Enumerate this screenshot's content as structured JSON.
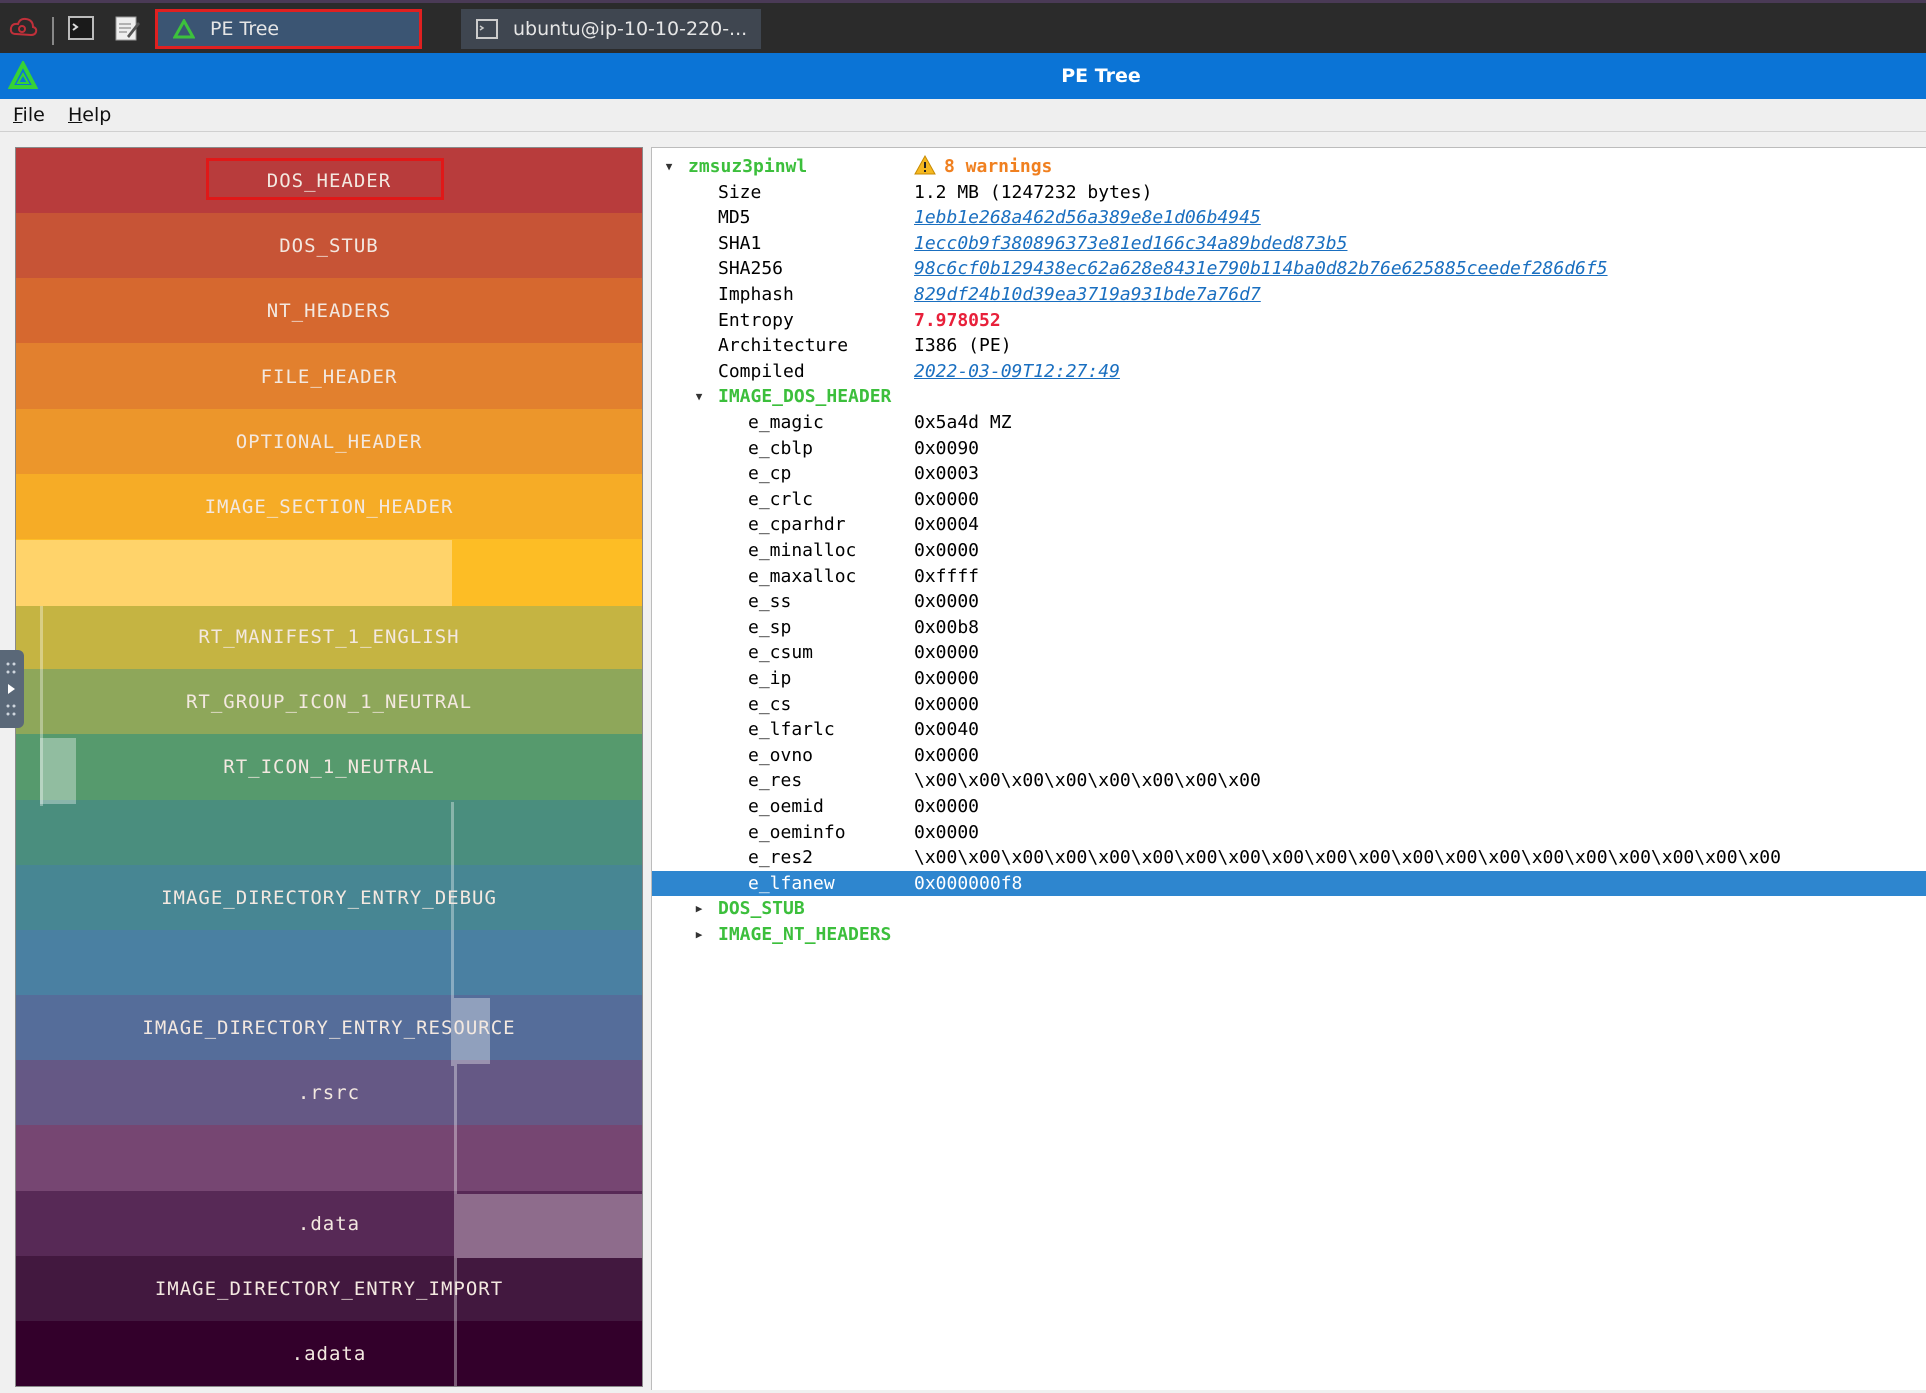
{
  "taskbar": {
    "tasks": [
      {
        "label": "PE Tree",
        "active": true
      },
      {
        "label": "ubuntu@ip-10-10-220-...",
        "active": false
      }
    ],
    "icons": [
      "cloud-icon",
      "terminal-icon",
      "notes-icon"
    ]
  },
  "window": {
    "title": "PE Tree"
  },
  "menu": [
    {
      "label": "File",
      "mnemonic": "F",
      "rest": "ile"
    },
    {
      "label": "Help",
      "mnemonic": "H",
      "rest": "elp"
    }
  ],
  "map": {
    "bands": [
      {
        "label": "DOS_HEADER",
        "color": "#b83c3c"
      },
      {
        "label": "DOS_STUB",
        "color": "#c75436"
      },
      {
        "label": "NT_HEADERS",
        "color": "#d6682f"
      },
      {
        "label": "FILE_HEADER",
        "color": "#e2802e"
      },
      {
        "label": "OPTIONAL_HEADER",
        "color": "#ec962b"
      },
      {
        "label": "IMAGE_SECTION_HEADER",
        "color": "#f6ac26"
      },
      {
        "label": "",
        "color": "#fdbd25"
      },
      {
        "label": "RT_MANIFEST_1_ENGLISH",
        "color": "#c5b442"
      },
      {
        "label": "RT_GROUP_ICON_1_NEUTRAL",
        "color": "#8ea75a"
      },
      {
        "label": "RT_ICON_1_NEUTRAL",
        "color": "#569a6d"
      },
      {
        "label": "",
        "color": "#4a8e7e"
      },
      {
        "label": "IMAGE_DIRECTORY_ENTRY_DEBUG",
        "color": "#478693"
      },
      {
        "label": "",
        "color": "#4a80a2"
      },
      {
        "label": "IMAGE_DIRECTORY_ENTRY_RESOURCE",
        "color": "#556d9a"
      },
      {
        "label": ".rsrc",
        "color": "#655885"
      },
      {
        "label": "",
        "color": "#764672"
      },
      {
        "label": ".data",
        "color": "#572956"
      },
      {
        "label": "IMAGE_DIRECTORY_ENTRY_IMPORT",
        "color": "#42183f"
      },
      {
        "label": ".adata",
        "color": "#33002b"
      }
    ]
  },
  "tree": {
    "root": {
      "name": "zmsuz3pinwl",
      "warnings": "8 warnings"
    },
    "summary": [
      {
        "key": "Size",
        "value": "1.2 MB (1247232 bytes)",
        "style": "plain"
      },
      {
        "key": "MD5",
        "value": "1ebb1e268a462d56a389e8e1d06b4945",
        "style": "link"
      },
      {
        "key": "SHA1",
        "value": "1ecc0b9f380896373e81ed166c34a89bded873b5",
        "style": "link"
      },
      {
        "key": "SHA256",
        "value": "98c6cf0b129438ec62a628e8431e790b114ba0d82b76e625885ceedef286d6f5",
        "style": "link"
      },
      {
        "key": "Imphash",
        "value": "829df24b10d39ea3719a931bde7a76d7",
        "style": "link"
      },
      {
        "key": "Entropy",
        "value": "7.978052",
        "style": "red"
      },
      {
        "key": "Architecture",
        "value": "I386 (PE)",
        "style": "plain"
      },
      {
        "key": "Compiled",
        "value": "2022-03-09T12:27:49",
        "style": "link"
      }
    ],
    "dos_header": {
      "name": "IMAGE_DOS_HEADER",
      "fields": [
        {
          "key": "e_magic",
          "value": "0x5a4d MZ"
        },
        {
          "key": "e_cblp",
          "value": "0x0090"
        },
        {
          "key": "e_cp",
          "value": "0x0003"
        },
        {
          "key": "e_crlc",
          "value": "0x0000"
        },
        {
          "key": "e_cparhdr",
          "value": "0x0004"
        },
        {
          "key": "e_minalloc",
          "value": "0x0000"
        },
        {
          "key": "e_maxalloc",
          "value": "0xffff"
        },
        {
          "key": "e_ss",
          "value": "0x0000"
        },
        {
          "key": "e_sp",
          "value": "0x00b8"
        },
        {
          "key": "e_csum",
          "value": "0x0000"
        },
        {
          "key": "e_ip",
          "value": "0x0000"
        },
        {
          "key": "e_cs",
          "value": "0x0000"
        },
        {
          "key": "e_lfarlc",
          "value": "0x0040"
        },
        {
          "key": "e_ovno",
          "value": "0x0000"
        },
        {
          "key": "e_res",
          "value": "\\x00\\x00\\x00\\x00\\x00\\x00\\x00\\x00"
        },
        {
          "key": "e_oemid",
          "value": "0x0000"
        },
        {
          "key": "e_oeminfo",
          "value": "0x0000"
        },
        {
          "key": "e_res2",
          "value": "\\x00\\x00\\x00\\x00\\x00\\x00\\x00\\x00\\x00\\x00\\x00\\x00\\x00\\x00\\x00\\x00\\x00\\x00\\x00\\x00"
        },
        {
          "key": "e_lfanew",
          "value": "0x000000f8",
          "selected": true
        }
      ]
    },
    "collapsed": [
      "DOS_STUB",
      "IMAGE_NT_HEADERS"
    ]
  }
}
